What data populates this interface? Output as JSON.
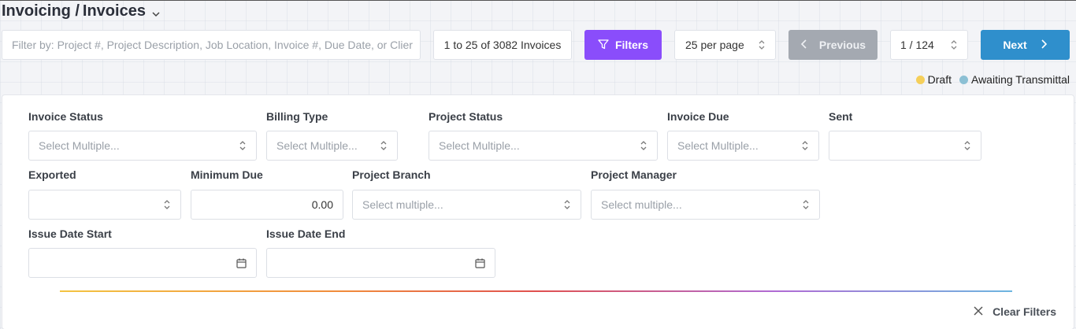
{
  "header": {
    "breadcrumb_parent": "Invoicing /",
    "breadcrumb_current": "Invoices"
  },
  "toolbar": {
    "search_placeholder": "Filter by: Project #, Project Description, Job Location, Invoice #, Due Date, or Clier",
    "search_value": "",
    "result_count": "1 to 25 of 3082 Invoices",
    "filters_label": "Filters",
    "per_page": "25 per page",
    "previous_label": "Previous",
    "page_indicator": "1 / 124",
    "next_label": "Next"
  },
  "legend": {
    "items": [
      {
        "label": "Draft",
        "color": "#f5cf5a"
      },
      {
        "label": "Awaiting Transmittal",
        "color": "#8cc0d4"
      }
    ]
  },
  "filters": {
    "invoice_status": {
      "label": "Invoice Status",
      "placeholder": "Select Multiple..."
    },
    "billing_type": {
      "label": "Billing Type",
      "placeholder": "Select Multiple..."
    },
    "project_status": {
      "label": "Project Status",
      "placeholder": "Select Multiple..."
    },
    "invoice_due": {
      "label": "Invoice Due",
      "placeholder": "Select Multiple..."
    },
    "sent": {
      "label": "Sent",
      "value": ""
    },
    "exported": {
      "label": "Exported",
      "value": ""
    },
    "minimum_due": {
      "label": "Minimum Due",
      "value": "0.00"
    },
    "project_branch": {
      "label": "Project Branch",
      "placeholder": "Select multiple..."
    },
    "project_manager": {
      "label": "Project Manager",
      "placeholder": "Select multiple..."
    },
    "issue_date_start": {
      "label": "Issue Date Start",
      "value": ""
    },
    "issue_date_end": {
      "label": "Issue Date End",
      "value": ""
    },
    "clear_label": "Clear Filters"
  },
  "colors": {
    "filters_button": "#8a4dfb",
    "next_button": "#2f8fcc",
    "previous_button_disabled": "#a4a9b1"
  }
}
